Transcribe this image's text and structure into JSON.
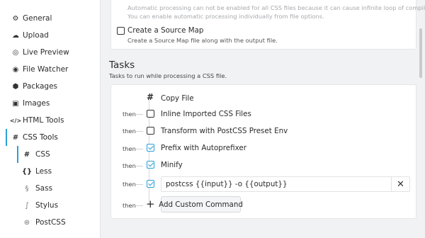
{
  "sidebar": {
    "items": [
      {
        "label": "General",
        "icon": "gear-icon",
        "glyph": "⚙"
      },
      {
        "label": "Upload",
        "icon": "cloud-icon",
        "glyph": "☁"
      },
      {
        "label": "Live Preview",
        "icon": "live-preview-icon",
        "glyph": "◎"
      },
      {
        "label": "File Watcher",
        "icon": "eye-icon",
        "glyph": "◉"
      },
      {
        "label": "Packages",
        "icon": "package-icon",
        "glyph": "⬢"
      },
      {
        "label": "Images",
        "icon": "image-icon",
        "glyph": "▣"
      },
      {
        "label": "HTML Tools",
        "icon": "code-icon",
        "glyph": "</>"
      },
      {
        "label": "CSS Tools",
        "icon": "hash-icon",
        "glyph": "#"
      }
    ],
    "sub_items": [
      {
        "label": "CSS",
        "icon": "hash-icon",
        "glyph": "#"
      },
      {
        "label": "Less",
        "icon": "braces-icon",
        "glyph": "{}"
      },
      {
        "label": "Sass",
        "icon": "sass-icon",
        "glyph": "§"
      },
      {
        "label": "Stylus",
        "icon": "stylus-icon",
        "glyph": "∫"
      },
      {
        "label": "PostCSS",
        "icon": "postcss-icon",
        "glyph": "⊛"
      }
    ]
  },
  "top": {
    "faded_line1": "Automatic processing can not be enabled for all CSS files because it can cause infinite loop of compilations.",
    "faded_line2": "You can enable automatic processing individually from file options.",
    "source_map_label": "Create a Source Map",
    "source_map_desc": "Create a Source Map file along with the output file."
  },
  "tasks": {
    "title": "Tasks",
    "desc": "Tasks to run while processing a CSS file.",
    "then_label": "then",
    "copy_file": "Copy File",
    "list": [
      {
        "label": "Inline Imported CSS Files",
        "checked": false
      },
      {
        "label": "Transform with PostCSS Preset Env",
        "checked": false
      },
      {
        "label": "Prefix with Autoprefixer",
        "checked": true
      },
      {
        "label": "Minify",
        "checked": true
      }
    ],
    "command_value": "postcss {{input}} -o {{output}}",
    "command_checked": true,
    "clear_glyph": "✕",
    "add_label": "Add Custom Command",
    "add_glyph": "+"
  },
  "colors": {
    "accent": "#2c9fd6"
  }
}
